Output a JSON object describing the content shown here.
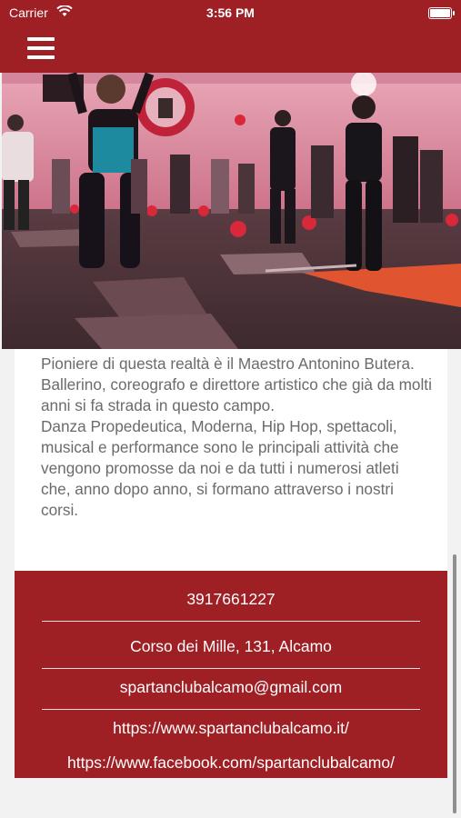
{
  "status_bar": {
    "carrier": "Carrier",
    "time": "3:56 PM"
  },
  "description": "Pioniere di questa realtà è il Maestro Antonino Butera. Ballerino, coreografo e direttore artistico che già da molti anni si fa strada in questo campo.\nDanza Propedeutica, Moderna, Hip Hop, spettacoli, musical e performance sono le principali attività che vengono promosse da noi e da tutti i numerosi atleti che, anno dopo anno, si formano attraverso i nostri corsi.",
  "contact": {
    "phone": "3917661227",
    "address": "Corso dei Mille, 131, Alcamo",
    "email": "spartanclubalcamo@gmail.com",
    "website": "https://www.spartanclubalcamo.it/",
    "facebook": "https://www.facebook.com/spartanclubalcamo/"
  },
  "colors": {
    "brand": "#9e1f24",
    "text_muted": "#6b6b6b"
  }
}
